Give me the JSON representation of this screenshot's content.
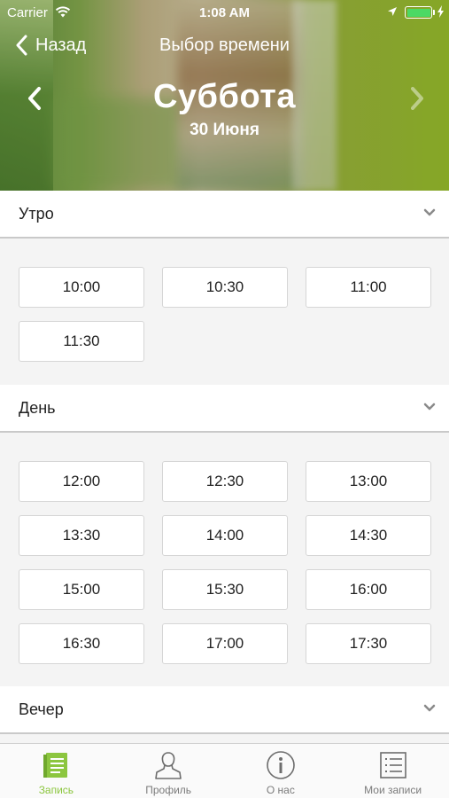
{
  "status_bar": {
    "carrier": "Carrier",
    "time": "1:08 AM",
    "battery_color": "#4cd964"
  },
  "nav": {
    "back_label": "Назад",
    "title": "Выбор времени"
  },
  "day": {
    "name": "Суббота",
    "date": "30 Июня"
  },
  "sections": [
    {
      "label": "Утро",
      "slots": [
        "10:00",
        "10:30",
        "11:00",
        "11:30"
      ]
    },
    {
      "label": "День",
      "slots": [
        "12:00",
        "12:30",
        "13:00",
        "13:30",
        "14:00",
        "14:30",
        "15:00",
        "15:30",
        "16:00",
        "16:30",
        "17:00",
        "17:30"
      ]
    },
    {
      "label": "Вечер",
      "slots": []
    }
  ],
  "tabbar": {
    "accent_color": "#8cc63f",
    "items": [
      {
        "label": "Запись",
        "icon": "document-icon",
        "active": true
      },
      {
        "label": "Профиль",
        "icon": "user-icon",
        "active": false
      },
      {
        "label": "О нас",
        "icon": "info-icon",
        "active": false
      },
      {
        "label": "Мои записи",
        "icon": "list-icon",
        "active": false
      }
    ]
  }
}
